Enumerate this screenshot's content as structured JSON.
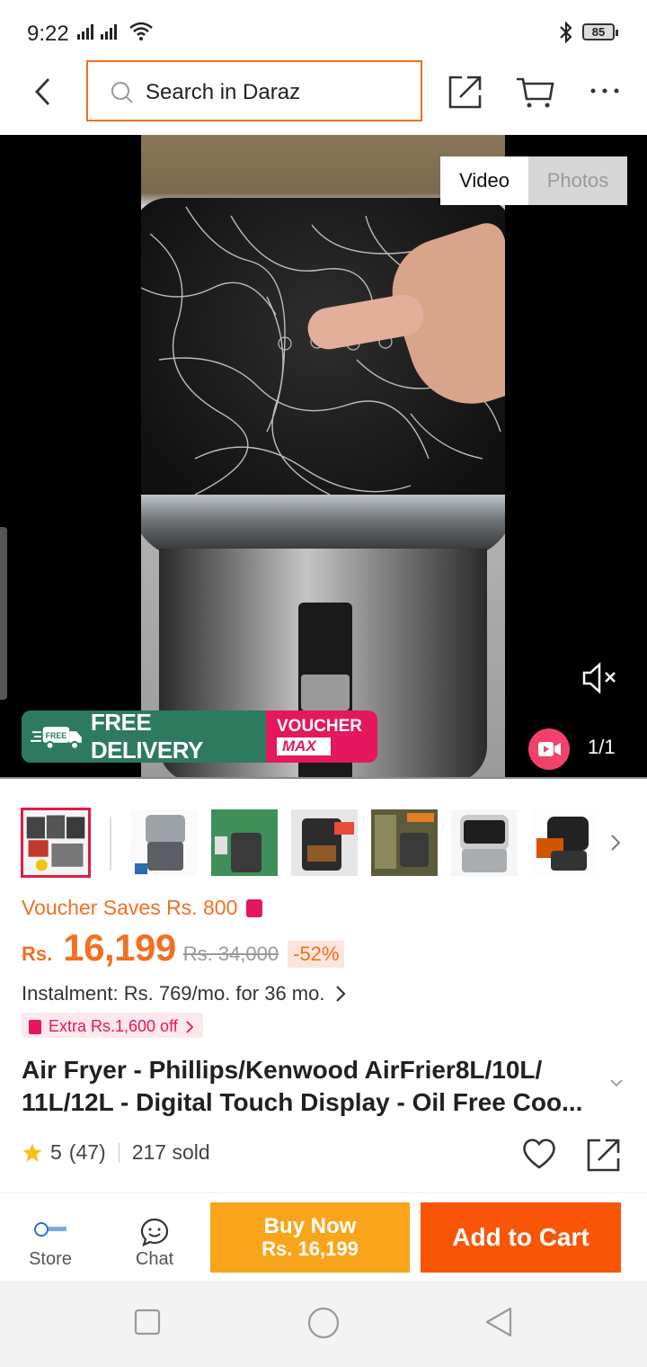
{
  "status_bar": {
    "time": "9:22",
    "battery": "85"
  },
  "header": {
    "search_placeholder": "Search in Daraz"
  },
  "media": {
    "tabs": [
      {
        "label": "Video"
      },
      {
        "label": "Photos"
      }
    ],
    "free_delivery": "FREE DELIVERY",
    "free_badge": "FREE",
    "voucher_line1": "VOUCHER",
    "voucher_line2": "MAX",
    "counter": "1/1"
  },
  "product": {
    "voucher_saves": "Voucher Saves Rs. 800",
    "currency": "Rs.",
    "price": "16,199",
    "old_price": "Rs. 34,000",
    "discount": "-52%",
    "instalment": "Instalment: Rs. 769/mo. for 36 mo.",
    "extra_off": "Extra Rs.1,600 off",
    "title": "Air Fryer - Phillips/Kenwood AirFrier8L/10L/ 11L/12L - Digital Touch Display - Oil Free Coo...",
    "rating_value": "5",
    "rating_count": "(47)",
    "sold": "217 sold"
  },
  "bottom_bar": {
    "store_label": "Store",
    "chat_label": "Chat",
    "buy_now_line1": "Buy Now",
    "buy_now_line2": "Rs. 16,199",
    "add_to_cart": "Add to Cart"
  },
  "colors": {
    "accent": "#f36f21",
    "cart": "#f85606",
    "buy": "#f9a51b",
    "voucher": "#e5175f",
    "delivery": "#2e7a5e"
  },
  "icons": [
    "back-icon",
    "search-icon",
    "share-icon",
    "cart-icon",
    "more-icon",
    "mute-icon",
    "video-icon",
    "chevron-right-icon",
    "star-icon",
    "heart-icon",
    "store-logo",
    "chat-icon"
  ]
}
